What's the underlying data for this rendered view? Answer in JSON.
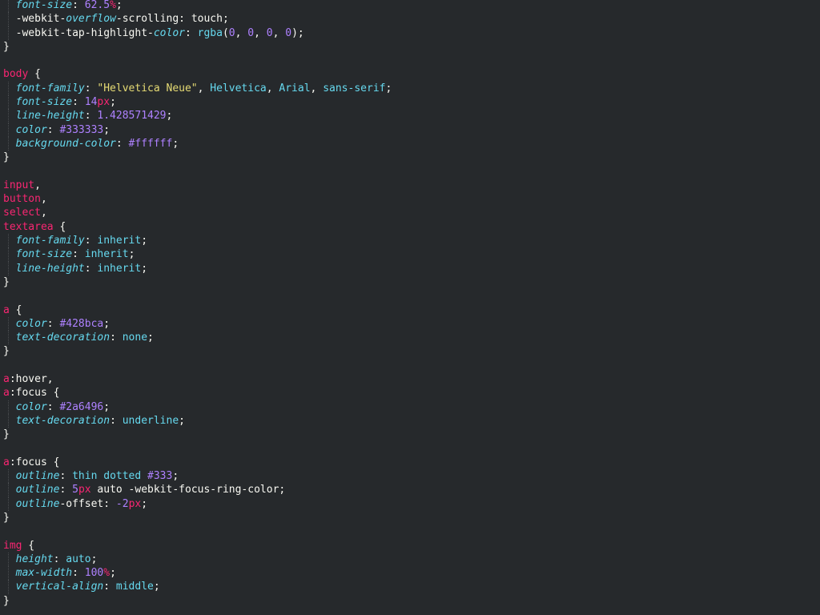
{
  "colors": {
    "background": "#26292c",
    "selector": "#f92672",
    "property": "#66d9ef",
    "number": "#ae81ff",
    "string": "#e6db74",
    "text": "#f8f8f2"
  },
  "lines": [
    [
      [
        "  ",
        "plain"
      ],
      [
        "font-size",
        "prop"
      ],
      [
        ": ",
        "punc"
      ],
      [
        "62.5",
        "num"
      ],
      [
        "%",
        "unit"
      ],
      [
        ";",
        "punc"
      ]
    ],
    [
      [
        "  ",
        "plain"
      ],
      [
        "-webkit-",
        "propn"
      ],
      [
        "overflow",
        "prop"
      ],
      [
        "-scrolling: touch;",
        "propn"
      ]
    ],
    [
      [
        "  ",
        "plain"
      ],
      [
        "-webkit-tap-highlight-",
        "propn"
      ],
      [
        "color",
        "prop"
      ],
      [
        ": ",
        "punc"
      ],
      [
        "rgba",
        "kw"
      ],
      [
        "(",
        "punc"
      ],
      [
        "0",
        "num"
      ],
      [
        ", ",
        "punc"
      ],
      [
        "0",
        "num"
      ],
      [
        ", ",
        "punc"
      ],
      [
        "0",
        "num"
      ],
      [
        ", ",
        "punc"
      ],
      [
        "0",
        "num"
      ],
      [
        ");",
        "punc"
      ]
    ],
    [
      [
        "}",
        "punc"
      ]
    ],
    [
      [
        "",
        "plain"
      ]
    ],
    [
      [
        "body",
        "sel"
      ],
      [
        " {",
        "punc"
      ]
    ],
    [
      [
        "  ",
        "plain"
      ],
      [
        "font-family",
        "prop"
      ],
      [
        ": ",
        "punc"
      ],
      [
        "\"Helvetica Neue\"",
        "str"
      ],
      [
        ", ",
        "punc"
      ],
      [
        "Helvetica",
        "kw"
      ],
      [
        ", ",
        "punc"
      ],
      [
        "Arial",
        "kw"
      ],
      [
        ", ",
        "punc"
      ],
      [
        "sans-serif",
        "kw"
      ],
      [
        ";",
        "punc"
      ]
    ],
    [
      [
        "  ",
        "plain"
      ],
      [
        "font-size",
        "prop"
      ],
      [
        ": ",
        "punc"
      ],
      [
        "14",
        "num"
      ],
      [
        "px",
        "unit"
      ],
      [
        ";",
        "punc"
      ]
    ],
    [
      [
        "  ",
        "plain"
      ],
      [
        "line-height",
        "prop"
      ],
      [
        ": ",
        "punc"
      ],
      [
        "1.428571429",
        "num"
      ],
      [
        ";",
        "punc"
      ]
    ],
    [
      [
        "  ",
        "plain"
      ],
      [
        "color",
        "prop"
      ],
      [
        ": ",
        "punc"
      ],
      [
        "#333333",
        "num"
      ],
      [
        ";",
        "punc"
      ]
    ],
    [
      [
        "  ",
        "plain"
      ],
      [
        "background-color",
        "prop"
      ],
      [
        ": ",
        "punc"
      ],
      [
        "#ffffff",
        "num"
      ],
      [
        ";",
        "punc"
      ]
    ],
    [
      [
        "}",
        "punc"
      ]
    ],
    [
      [
        "",
        "plain"
      ]
    ],
    [
      [
        "input",
        "sel"
      ],
      [
        ",",
        "punc"
      ]
    ],
    [
      [
        "button",
        "sel"
      ],
      [
        ",",
        "punc"
      ]
    ],
    [
      [
        "select",
        "sel"
      ],
      [
        ",",
        "punc"
      ]
    ],
    [
      [
        "textarea",
        "sel"
      ],
      [
        " {",
        "punc"
      ]
    ],
    [
      [
        "  ",
        "plain"
      ],
      [
        "font-family",
        "prop"
      ],
      [
        ": ",
        "punc"
      ],
      [
        "inherit",
        "kw"
      ],
      [
        ";",
        "punc"
      ]
    ],
    [
      [
        "  ",
        "plain"
      ],
      [
        "font-size",
        "prop"
      ],
      [
        ": ",
        "punc"
      ],
      [
        "inherit",
        "kw"
      ],
      [
        ";",
        "punc"
      ]
    ],
    [
      [
        "  ",
        "plain"
      ],
      [
        "line-height",
        "prop"
      ],
      [
        ": ",
        "punc"
      ],
      [
        "inherit",
        "kw"
      ],
      [
        ";",
        "punc"
      ]
    ],
    [
      [
        "}",
        "punc"
      ]
    ],
    [
      [
        "",
        "plain"
      ]
    ],
    [
      [
        "a",
        "sel"
      ],
      [
        " {",
        "punc"
      ]
    ],
    [
      [
        "  ",
        "plain"
      ],
      [
        "color",
        "prop"
      ],
      [
        ": ",
        "punc"
      ],
      [
        "#428bca",
        "num"
      ],
      [
        ";",
        "punc"
      ]
    ],
    [
      [
        "  ",
        "plain"
      ],
      [
        "text-decoration",
        "prop"
      ],
      [
        ": ",
        "punc"
      ],
      [
        "none",
        "kw"
      ],
      [
        ";",
        "punc"
      ]
    ],
    [
      [
        "}",
        "punc"
      ]
    ],
    [
      [
        "",
        "plain"
      ]
    ],
    [
      [
        "a",
        "sel"
      ],
      [
        ":hover,",
        "punc"
      ]
    ],
    [
      [
        "a",
        "sel"
      ],
      [
        ":focus {",
        "punc"
      ]
    ],
    [
      [
        "  ",
        "plain"
      ],
      [
        "color",
        "prop"
      ],
      [
        ": ",
        "punc"
      ],
      [
        "#2a6496",
        "num"
      ],
      [
        ";",
        "punc"
      ]
    ],
    [
      [
        "  ",
        "plain"
      ],
      [
        "text-decoration",
        "prop"
      ],
      [
        ": ",
        "punc"
      ],
      [
        "underline",
        "kw"
      ],
      [
        ";",
        "punc"
      ]
    ],
    [
      [
        "}",
        "punc"
      ]
    ],
    [
      [
        "",
        "plain"
      ]
    ],
    [
      [
        "a",
        "sel"
      ],
      [
        ":focus {",
        "punc"
      ]
    ],
    [
      [
        "  ",
        "plain"
      ],
      [
        "outline",
        "prop"
      ],
      [
        ": ",
        "punc"
      ],
      [
        "thin dotted ",
        "kw"
      ],
      [
        "#333",
        "num"
      ],
      [
        ";",
        "punc"
      ]
    ],
    [
      [
        "  ",
        "plain"
      ],
      [
        "outline",
        "prop"
      ],
      [
        ": ",
        "punc"
      ],
      [
        "5",
        "num"
      ],
      [
        "px",
        "unit"
      ],
      [
        " auto -webkit-focus-ring-color;",
        "plain"
      ]
    ],
    [
      [
        "  ",
        "plain"
      ],
      [
        "outline",
        "prop"
      ],
      [
        "-offset: ",
        "propn"
      ],
      [
        "-2",
        "num"
      ],
      [
        "px",
        "unit"
      ],
      [
        ";",
        "punc"
      ]
    ],
    [
      [
        "}",
        "punc"
      ]
    ],
    [
      [
        "",
        "plain"
      ]
    ],
    [
      [
        "img",
        "sel"
      ],
      [
        " {",
        "punc"
      ]
    ],
    [
      [
        "  ",
        "plain"
      ],
      [
        "height",
        "prop"
      ],
      [
        ": ",
        "punc"
      ],
      [
        "auto",
        "kw"
      ],
      [
        ";",
        "punc"
      ]
    ],
    [
      [
        "  ",
        "plain"
      ],
      [
        "max-width",
        "prop"
      ],
      [
        ": ",
        "punc"
      ],
      [
        "100",
        "num"
      ],
      [
        "%",
        "unit"
      ],
      [
        ";",
        "punc"
      ]
    ],
    [
      [
        "  ",
        "plain"
      ],
      [
        "vertical-align",
        "prop"
      ],
      [
        ": ",
        "punc"
      ],
      [
        "middle",
        "kw"
      ],
      [
        ";",
        "punc"
      ]
    ],
    [
      [
        "}",
        "punc"
      ]
    ]
  ]
}
